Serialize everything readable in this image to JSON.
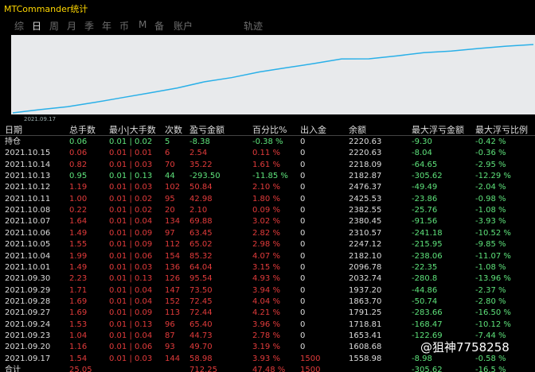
{
  "window": {
    "title": "MTCommander统计"
  },
  "tabs": [
    {
      "label": "综",
      "active": false
    },
    {
      "label": "日",
      "active": true
    },
    {
      "label": "周",
      "active": false
    },
    {
      "label": "月",
      "active": false
    },
    {
      "label": "季",
      "active": false
    },
    {
      "label": "年",
      "active": false
    },
    {
      "label": "币",
      "active": false
    },
    {
      "label": "M",
      "active": false
    },
    {
      "label": "备",
      "active": false
    },
    {
      "label": "账户",
      "active": false
    },
    {
      "label": "轨迹",
      "active": false
    }
  ],
  "chart_data": {
    "type": "line",
    "x_start_label": "2021.09.17",
    "series_color": "#2ab0e8",
    "values": [
      1558.98,
      1608.68,
      1653.41,
      1718.81,
      1791.25,
      1863.7,
      1937.2,
      2032.74,
      2096.78,
      2182.1,
      2247.12,
      2310.57,
      2380.45,
      2382.55,
      2425.53,
      2476.37,
      2182.87,
      2218.09,
      2220.63,
      2220.63
    ],
    "display_values": [
      1558.98,
      1608.68,
      1653.41,
      1718.81,
      1791.25,
      1863.7,
      1937.2,
      2032.74,
      2096.78,
      2182.1,
      2247.12,
      2310.57,
      2380.45,
      2382.55,
      2425.53,
      2476.37,
      2500,
      2540,
      2575,
      2600
    ]
  },
  "table": {
    "headers": {
      "date": "日期",
      "hands": "总手数",
      "minmax": "最小|大手数",
      "count": "次数",
      "pl": "盈亏金额",
      "pct": "百分比%",
      "inout": "出入金",
      "bal": "余额",
      "maxamt": "最大浮亏金额",
      "maxpct": "最大浮亏比例"
    },
    "rows": [
      {
        "date": "持仓",
        "hands": "0.06",
        "minmax": "0.01 | 0.02",
        "count": "5",
        "pl": "-8.38",
        "pct": "-0.38 %",
        "inout": "0",
        "bal": "2220.63",
        "maxamt": "-9.30",
        "maxpct": "-0.42 %",
        "sign": "neg"
      },
      {
        "date": "2021.10.15",
        "hands": "0.06",
        "minmax": "0.01 | 0.01",
        "count": "6",
        "pl": "2.54",
        "pct": "0.11 %",
        "inout": "0",
        "bal": "2220.63",
        "maxamt": "-8.04",
        "maxpct": "-0.36 %",
        "sign": "pos"
      },
      {
        "date": "2021.10.14",
        "hands": "0.82",
        "minmax": "0.01 | 0.03",
        "count": "70",
        "pl": "35.22",
        "pct": "1.61 %",
        "inout": "0",
        "bal": "2218.09",
        "maxamt": "-64.65",
        "maxpct": "-2.95 %",
        "sign": "pos"
      },
      {
        "date": "2021.10.13",
        "hands": "0.95",
        "minmax": "0.01 | 0.13",
        "count": "44",
        "pl": "-293.50",
        "pct": "-11.85 %",
        "inout": "0",
        "bal": "2182.87",
        "maxamt": "-305.62",
        "maxpct": "-12.29 %",
        "sign": "neg"
      },
      {
        "date": "2021.10.12",
        "hands": "1.19",
        "minmax": "0.01 | 0.03",
        "count": "102",
        "pl": "50.84",
        "pct": "2.10 %",
        "inout": "0",
        "bal": "2476.37",
        "maxamt": "-49.49",
        "maxpct": "-2.04 %",
        "sign": "pos"
      },
      {
        "date": "2021.10.11",
        "hands": "1.00",
        "minmax": "0.01 | 0.02",
        "count": "95",
        "pl": "42.98",
        "pct": "1.80 %",
        "inout": "0",
        "bal": "2425.53",
        "maxamt": "-23.86",
        "maxpct": "-0.98 %",
        "sign": "pos"
      },
      {
        "date": "2021.10.08",
        "hands": "0.22",
        "minmax": "0.01 | 0.02",
        "count": "20",
        "pl": "2.10",
        "pct": "0.09 %",
        "inout": "0",
        "bal": "2382.55",
        "maxamt": "-25.76",
        "maxpct": "-1.08 %",
        "sign": "pos"
      },
      {
        "date": "2021.10.07",
        "hands": "1.64",
        "minmax": "0.01 | 0.04",
        "count": "134",
        "pl": "69.88",
        "pct": "3.02 %",
        "inout": "0",
        "bal": "2380.45",
        "maxamt": "-91.56",
        "maxpct": "-3.93 %",
        "sign": "pos"
      },
      {
        "date": "2021.10.06",
        "hands": "1.49",
        "minmax": "0.01 | 0.09",
        "count": "97",
        "pl": "63.45",
        "pct": "2.82 %",
        "inout": "0",
        "bal": "2310.57",
        "maxamt": "-241.18",
        "maxpct": "-10.52 %",
        "sign": "pos"
      },
      {
        "date": "2021.10.05",
        "hands": "1.55",
        "minmax": "0.01 | 0.09",
        "count": "112",
        "pl": "65.02",
        "pct": "2.98 %",
        "inout": "0",
        "bal": "2247.12",
        "maxamt": "-215.95",
        "maxpct": "-9.85 %",
        "sign": "pos"
      },
      {
        "date": "2021.10.04",
        "hands": "1.99",
        "minmax": "0.01 | 0.06",
        "count": "154",
        "pl": "85.32",
        "pct": "4.07 %",
        "inout": "0",
        "bal": "2182.10",
        "maxamt": "-238.06",
        "maxpct": "-11.07 %",
        "sign": "pos"
      },
      {
        "date": "2021.10.01",
        "hands": "1.49",
        "minmax": "0.01 | 0.03",
        "count": "136",
        "pl": "64.04",
        "pct": "3.15 %",
        "inout": "0",
        "bal": "2096.78",
        "maxamt": "-22.35",
        "maxpct": "-1.08 %",
        "sign": "pos"
      },
      {
        "date": "2021.09.30",
        "hands": "2.23",
        "minmax": "0.01 | 0.13",
        "count": "126",
        "pl": "95.54",
        "pct": "4.93 %",
        "inout": "0",
        "bal": "2032.74",
        "maxamt": "-280.8",
        "maxpct": "-13.96 %",
        "sign": "pos"
      },
      {
        "date": "2021.09.29",
        "hands": "1.71",
        "minmax": "0.01 | 0.04",
        "count": "147",
        "pl": "73.50",
        "pct": "3.94 %",
        "inout": "0",
        "bal": "1937.20",
        "maxamt": "-44.86",
        "maxpct": "-2.37 %",
        "sign": "pos"
      },
      {
        "date": "2021.09.28",
        "hands": "1.69",
        "minmax": "0.01 | 0.04",
        "count": "152",
        "pl": "72.45",
        "pct": "4.04 %",
        "inout": "0",
        "bal": "1863.70",
        "maxamt": "-50.74",
        "maxpct": "-2.80 %",
        "sign": "pos"
      },
      {
        "date": "2021.09.27",
        "hands": "1.69",
        "minmax": "0.01 | 0.09",
        "count": "113",
        "pl": "72.44",
        "pct": "4.21 %",
        "inout": "0",
        "bal": "1791.25",
        "maxamt": "-283.66",
        "maxpct": "-16.50 %",
        "sign": "pos"
      },
      {
        "date": "2021.09.24",
        "hands": "1.53",
        "minmax": "0.01 | 0.13",
        "count": "96",
        "pl": "65.40",
        "pct": "3.96 %",
        "inout": "0",
        "bal": "1718.81",
        "maxamt": "-168.47",
        "maxpct": "-10.12 %",
        "sign": "pos"
      },
      {
        "date": "2021.09.23",
        "hands": "1.04",
        "minmax": "0.01 | 0.04",
        "count": "87",
        "pl": "44.73",
        "pct": "2.78 %",
        "inout": "0",
        "bal": "1653.41",
        "maxamt": "-122.69",
        "maxpct": "-7.44 %",
        "sign": "pos"
      },
      {
        "date": "2021.09.20",
        "hands": "1.16",
        "minmax": "0.01 | 0.06",
        "count": "93",
        "pl": "49.70",
        "pct": "3.19 %",
        "inout": "0",
        "bal": "1608.68",
        "maxamt": "",
        "maxpct": "",
        "sign": "pos"
      },
      {
        "date": "2021.09.17",
        "hands": "1.54",
        "minmax": "0.01 | 0.03",
        "count": "144",
        "pl": "58.98",
        "pct": "3.93 %",
        "inout": "1500",
        "bal": "1558.98",
        "maxamt": "-8.98",
        "maxpct": "-0.58 %",
        "sign": "pos"
      }
    ],
    "total": {
      "date": "合计",
      "hands": "25.05",
      "minmax": "",
      "count": "",
      "pl": "712.25",
      "pct": "47.48 %",
      "inout": "1500",
      "bal": "",
      "maxamt": "-305.62",
      "maxpct": "-16.5 %"
    }
  },
  "watermark": "@狙神7758258"
}
